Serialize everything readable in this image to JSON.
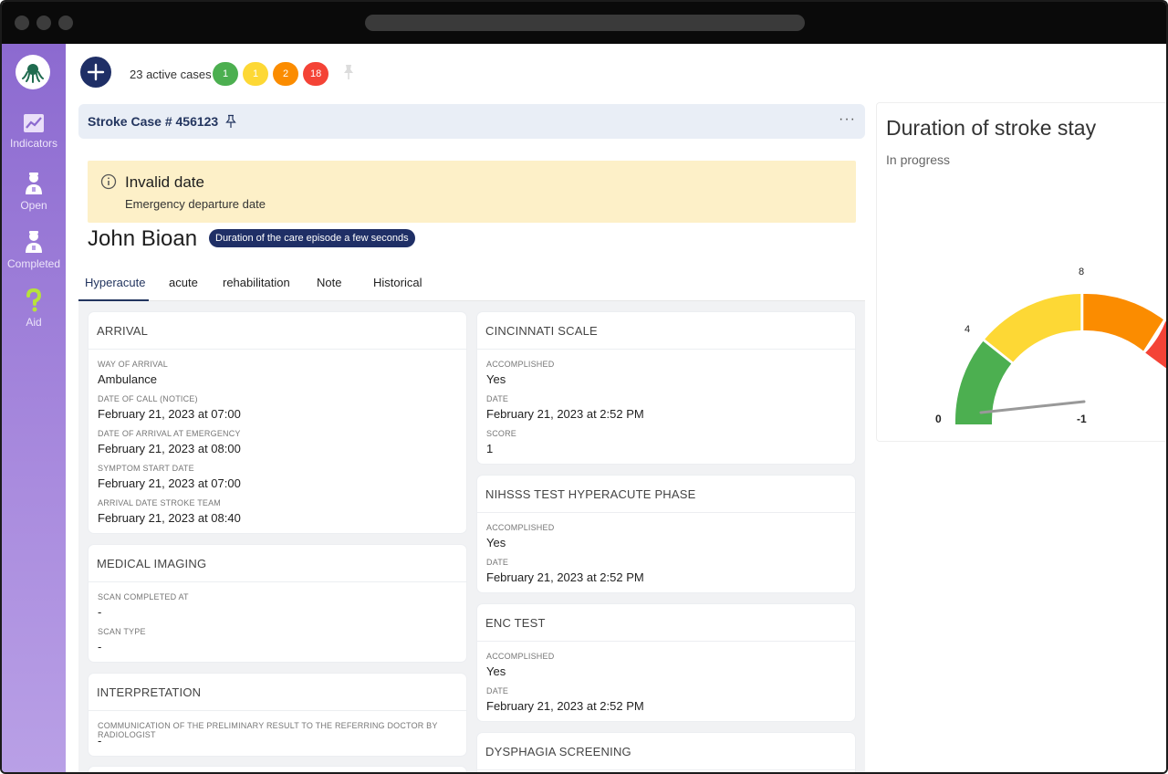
{
  "colors": {
    "primary_navy": "#1f2f66",
    "sidebar_purple": "#8c6ad0",
    "alert_bg": "#fdf0c8",
    "gauge_green": "#4caf50",
    "gauge_yellow": "#fdd835",
    "gauge_orange": "#fb8c00",
    "gauge_red": "#f44336"
  },
  "sidebar": {
    "items": [
      {
        "label": "Indicators",
        "icon": "chart-icon"
      },
      {
        "label": "Open",
        "icon": "doctor-icon"
      },
      {
        "label": "Completed",
        "icon": "doctor-icon"
      },
      {
        "label": "Aid",
        "icon": "question-icon"
      }
    ]
  },
  "topbar": {
    "active_cases": "23 active cases",
    "pills": [
      {
        "value": "1",
        "color": "#4caf50"
      },
      {
        "value": "1",
        "color": "#fdd835"
      },
      {
        "value": "2",
        "color": "#fb8c00"
      },
      {
        "value": "18",
        "color": "#f44336"
      }
    ]
  },
  "case": {
    "title": "Stroke Case # 456123",
    "menu": "···"
  },
  "alert": {
    "title": "Invalid date",
    "subtitle": "Emergency departure date"
  },
  "patient": {
    "name": "John Bioan",
    "duration_badge": "Duration of the care episode a few seconds"
  },
  "tabs": [
    {
      "label": "Hyperacute",
      "active": true
    },
    {
      "label": "acute",
      "active": false
    },
    {
      "label": "rehabilitation",
      "active": false
    },
    {
      "label": "Note",
      "active": false
    },
    {
      "label": "Historical",
      "active": false
    }
  ],
  "cards": {
    "arrival": {
      "title": "ARRIVAL",
      "fields": [
        {
          "label": "WAY OF ARRIVAL",
          "value": "Ambulance"
        },
        {
          "label": "DATE OF CALL (NOTICE)",
          "value": "February 21, 2023 at 07:00"
        },
        {
          "label": "DATE OF ARRIVAL AT EMERGENCY",
          "value": "February 21, 2023 at 08:00"
        },
        {
          "label": "SYMPTOM START DATE",
          "value": "February 21, 2023 at 07:00"
        },
        {
          "label": "ARRIVAL DATE STROKE TEAM",
          "value": "February 21, 2023 at 08:40"
        }
      ]
    },
    "imaging": {
      "title": "MEDICAL IMAGING",
      "fields": [
        {
          "label": "SCAN COMPLETED AT",
          "value": "-"
        },
        {
          "label": "SCAN TYPE",
          "value": "-"
        }
      ]
    },
    "interpretation": {
      "title": "INTERPRETATION",
      "fields": [
        {
          "label": "COMMUNICATION OF THE PRELIMINARY RESULT TO THE REFERRING DOCTOR BY RADIOLOGIST",
          "value": "-"
        }
      ]
    },
    "cincinnati": {
      "title": "CINCINNATI SCALE",
      "fields": [
        {
          "label": "ACCOMPLISHED",
          "value": "Yes"
        },
        {
          "label": "DATE",
          "value": "February 21, 2023 at 2:52 PM"
        },
        {
          "label": "SCORE",
          "value": "1"
        }
      ]
    },
    "nihsss": {
      "title": "NIHSSS TEST HYPERACUTE PHASE",
      "fields": [
        {
          "label": "ACCOMPLISHED",
          "value": "Yes"
        },
        {
          "label": "DATE",
          "value": "February 21, 2023 at 2:52 PM"
        }
      ]
    },
    "enc": {
      "title": "ENC TEST",
      "fields": [
        {
          "label": "ACCOMPLISHED",
          "value": "Yes"
        },
        {
          "label": "DATE",
          "value": "February 21, 2023 at 2:52 PM"
        }
      ]
    },
    "dysphagia": {
      "title": "DYSPHAGIA SCREENING"
    }
  },
  "gauge": {
    "title": "Duration of stroke stay",
    "subtitle": "In progress",
    "tick_labels": [
      "0",
      "4",
      "8"
    ],
    "value_label": "-1",
    "min": 0,
    "value": -1
  }
}
